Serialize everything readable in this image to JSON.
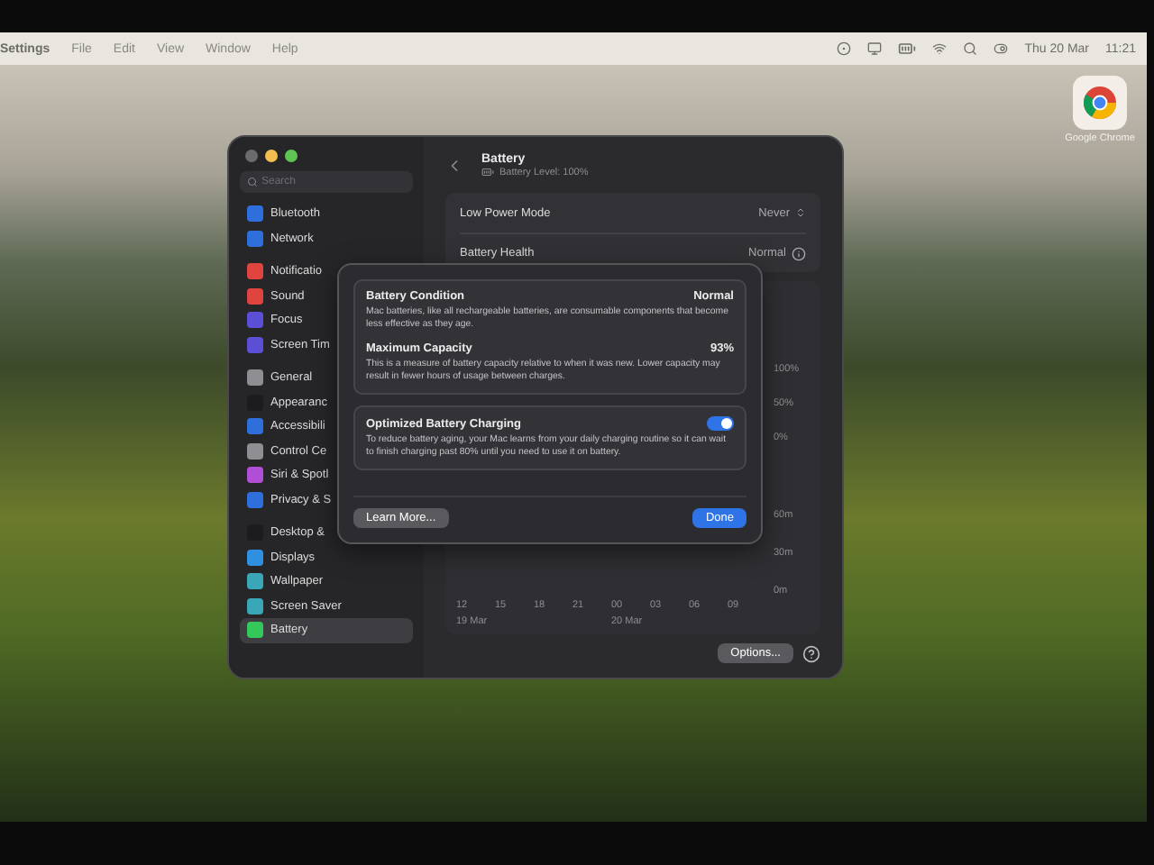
{
  "menu_bar": {
    "app": "Settings",
    "menus": [
      "File",
      "Edit",
      "View",
      "Window",
      "Help"
    ],
    "date": "Thu 20 Mar",
    "time": "11:21"
  },
  "desktop_icons": [
    {
      "label": "Google Chrome"
    }
  ],
  "window": {
    "search": {
      "placeholder": "Search"
    },
    "sidebar": [
      {
        "items": [
          {
            "label": "Bluetooth",
            "color": "#2f6fdc",
            "selected": false
          },
          {
            "label": "Network",
            "color": "#2f6fdc",
            "selected": false
          }
        ]
      },
      {
        "items": [
          {
            "label": "Notificatio",
            "color": "#e0443e",
            "selected": false
          },
          {
            "label": "Sound",
            "color": "#e0443e",
            "selected": false
          },
          {
            "label": "Focus",
            "color": "#5b4fd6",
            "selected": false
          },
          {
            "label": "Screen Tim",
            "color": "#5b4fd6",
            "selected": false
          }
        ]
      },
      {
        "items": [
          {
            "label": "General",
            "color": "#8e8e93",
            "selected": false
          },
          {
            "label": "Appearanc",
            "color": "#1c1c1e",
            "selected": false
          },
          {
            "label": "Accessibili",
            "color": "#2f6fdc",
            "selected": false
          },
          {
            "label": "Control Ce",
            "color": "#8e8e93",
            "selected": false
          },
          {
            "label": "Siri & Spotl",
            "color": "#b04fd6",
            "selected": false
          },
          {
            "label": "Privacy & S",
            "color": "#2f6fdc",
            "selected": false
          }
        ]
      },
      {
        "items": [
          {
            "label": "Desktop &",
            "color": "#1c1c1e",
            "selected": false
          },
          {
            "label": "Displays",
            "color": "#2f8fe0",
            "selected": false
          },
          {
            "label": "Wallpaper",
            "color": "#3aa7b8",
            "selected": false
          },
          {
            "label": "Screen Saver",
            "color": "#3aa7b8",
            "selected": false
          },
          {
            "label": "Battery",
            "color": "#34c759",
            "selected": true
          }
        ]
      }
    ],
    "header": {
      "title": "Battery",
      "subtitle": "Battery Level: 100%"
    },
    "settings_rows": [
      {
        "label": "Low Power Mode",
        "value": "Never",
        "kind": "popup"
      },
      {
        "label": "Battery Health",
        "value": "Normal",
        "kind": "info"
      }
    ],
    "usage_chart": {
      "level_ticks": [
        "100%",
        "50%",
        "0%"
      ],
      "usage_ticks": [
        "60m",
        "30m",
        "0m"
      ],
      "hours": [
        {
          "hour": "12",
          "date": "19 Mar"
        },
        {
          "hour": "15"
        },
        {
          "hour": "18"
        },
        {
          "hour": "21"
        },
        {
          "hour": "00",
          "date": "20 Mar"
        },
        {
          "hour": "03"
        },
        {
          "hour": "06"
        },
        {
          "hour": "09"
        }
      ]
    },
    "options_button": "Options...",
    "dialog": {
      "cards": [
        {
          "sections": [
            {
              "kind": "info",
              "title": "Battery Condition",
              "value": "Normal",
              "description": "Mac batteries, like all rechargeable batteries, are consumable components that become less effective as they age."
            },
            {
              "kind": "info",
              "title": "Maximum Capacity",
              "value": "93%",
              "description": "This is a measure of battery capacity relative to when it was new. Lower capacity may result in fewer hours of usage between charges."
            }
          ]
        },
        {
          "sections": [
            {
              "kind": "toggle",
              "title": "Optimized Battery Charging",
              "on": true,
              "description": "To reduce battery aging, your Mac learns from your daily charging routine so it can wait to finish charging past 80% until you need to use it on battery."
            }
          ]
        }
      ],
      "buttons": [
        {
          "label": "Learn More...",
          "kind": "secondary"
        },
        {
          "label": "Done",
          "kind": "primary"
        }
      ]
    }
  }
}
